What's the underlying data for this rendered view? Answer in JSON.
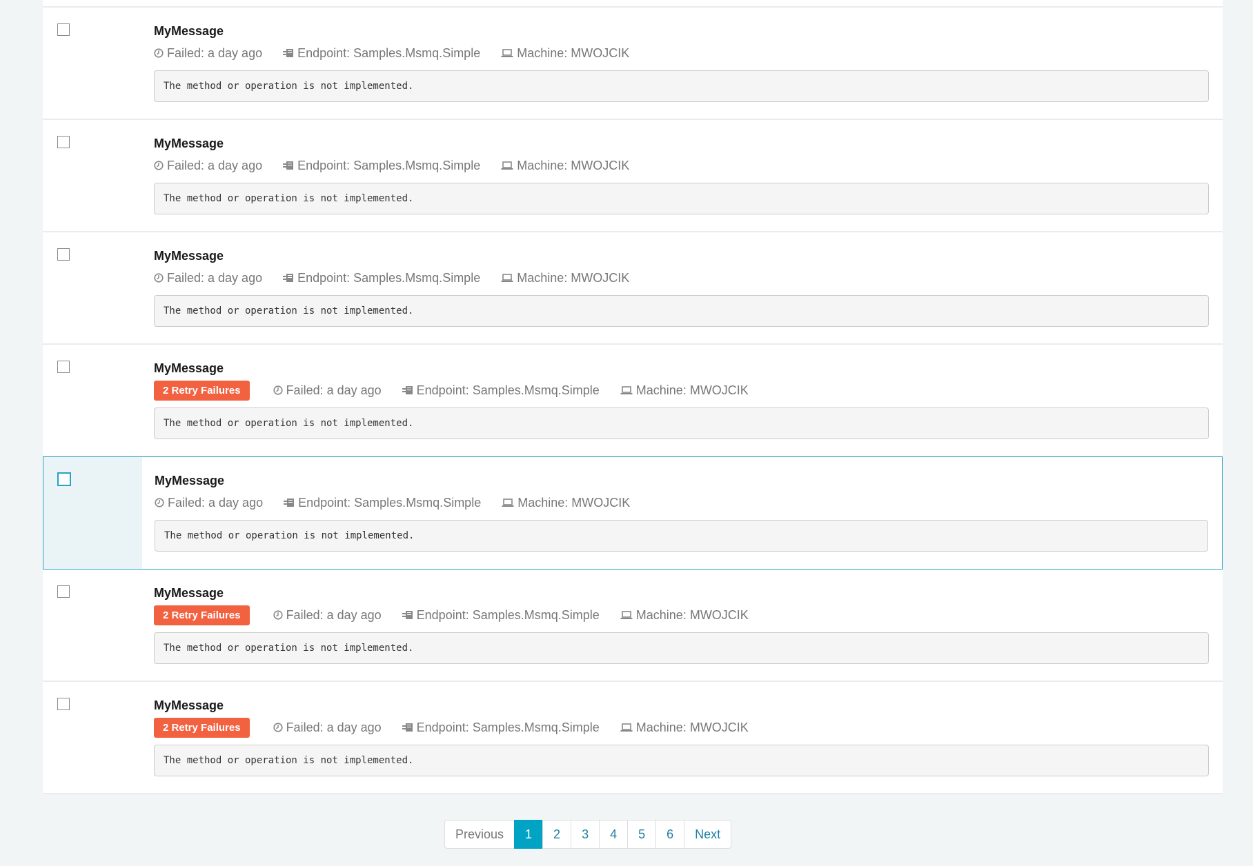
{
  "messages": [
    {
      "title": "MyMessage",
      "retry_badge": "",
      "failed": "Failed: a day ago",
      "endpoint": "Endpoint: Samples.Msmq.Simple",
      "machine": "Machine: MWOJCIK",
      "exception": "The method or operation is not implemented.",
      "selected": false
    },
    {
      "title": "MyMessage",
      "retry_badge": "",
      "failed": "Failed: a day ago",
      "endpoint": "Endpoint: Samples.Msmq.Simple",
      "machine": "Machine: MWOJCIK",
      "exception": "The method or operation is not implemented.",
      "selected": false
    },
    {
      "title": "MyMessage",
      "retry_badge": "",
      "failed": "Failed: a day ago",
      "endpoint": "Endpoint: Samples.Msmq.Simple",
      "machine": "Machine: MWOJCIK",
      "exception": "The method or operation is not implemented.",
      "selected": false
    },
    {
      "title": "MyMessage",
      "retry_badge": "2 Retry Failures",
      "failed": "Failed: a day ago",
      "endpoint": "Endpoint: Samples.Msmq.Simple",
      "machine": "Machine: MWOJCIK",
      "exception": "The method or operation is not implemented.",
      "selected": false
    },
    {
      "title": "MyMessage",
      "retry_badge": "",
      "failed": "Failed: a day ago",
      "endpoint": "Endpoint: Samples.Msmq.Simple",
      "machine": "Machine: MWOJCIK",
      "exception": "The method or operation is not implemented.",
      "selected": true
    },
    {
      "title": "MyMessage",
      "retry_badge": "2 Retry Failures",
      "failed": "Failed: a day ago",
      "endpoint": "Endpoint: Samples.Msmq.Simple",
      "machine": "Machine: MWOJCIK",
      "exception": "The method or operation is not implemented.",
      "selected": false
    },
    {
      "title": "MyMessage",
      "retry_badge": "2 Retry Failures",
      "failed": "Failed: a day ago",
      "endpoint": "Endpoint: Samples.Msmq.Simple",
      "machine": "Machine: MWOJCIK",
      "exception": "The method or operation is not implemented.",
      "selected": false
    }
  ],
  "pagination": {
    "previous": "Previous",
    "pages": [
      "1",
      "2",
      "3",
      "4",
      "5",
      "6"
    ],
    "active_page": "1",
    "next": "Next"
  },
  "colors": {
    "accent": "#00a3c4",
    "badge": "#f26140",
    "selected_border": "#2aa2c0"
  },
  "icons": {
    "failed": "clock-icon",
    "endpoint": "server-icon",
    "machine": "laptop-icon"
  }
}
